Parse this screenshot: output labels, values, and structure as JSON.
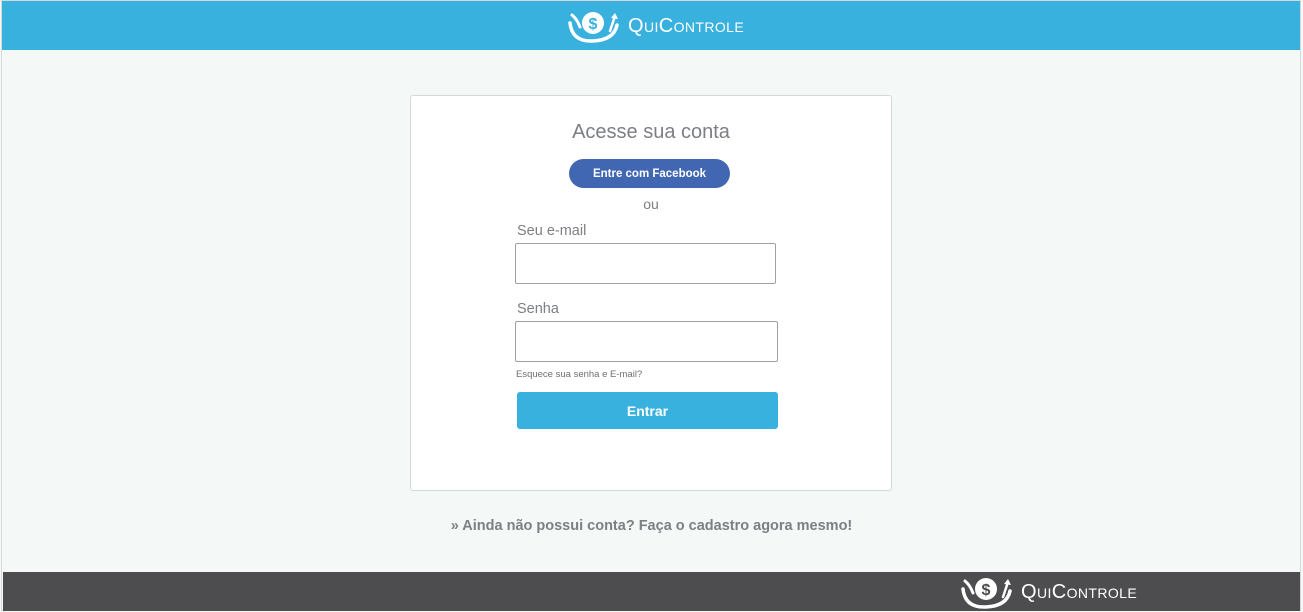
{
  "header": {
    "brand_name": "QuiControle",
    "logo_icon": "money-hand-icon"
  },
  "login": {
    "title": "Acesse sua conta",
    "facebook_button": "Entre com Facebook",
    "or_text": "ou",
    "email_label": "Seu e-mail",
    "email_value": "",
    "password_label": "Senha",
    "password_value": "",
    "forgot_link": "Esquece sua senha e E-mail?",
    "submit_button": "Entrar"
  },
  "signup_link": "» Ainda não possui conta? Faça o cadastro agora mesmo!",
  "footer": {
    "brand_name": "QuiControle",
    "logo_icon": "money-hand-icon"
  },
  "colors": {
    "header_bg": "#39b1df",
    "facebook": "#4267b2",
    "primary_button": "#39b1df",
    "footer_bg": "#4d4d4f",
    "page_bg": "#f4f8f7"
  }
}
